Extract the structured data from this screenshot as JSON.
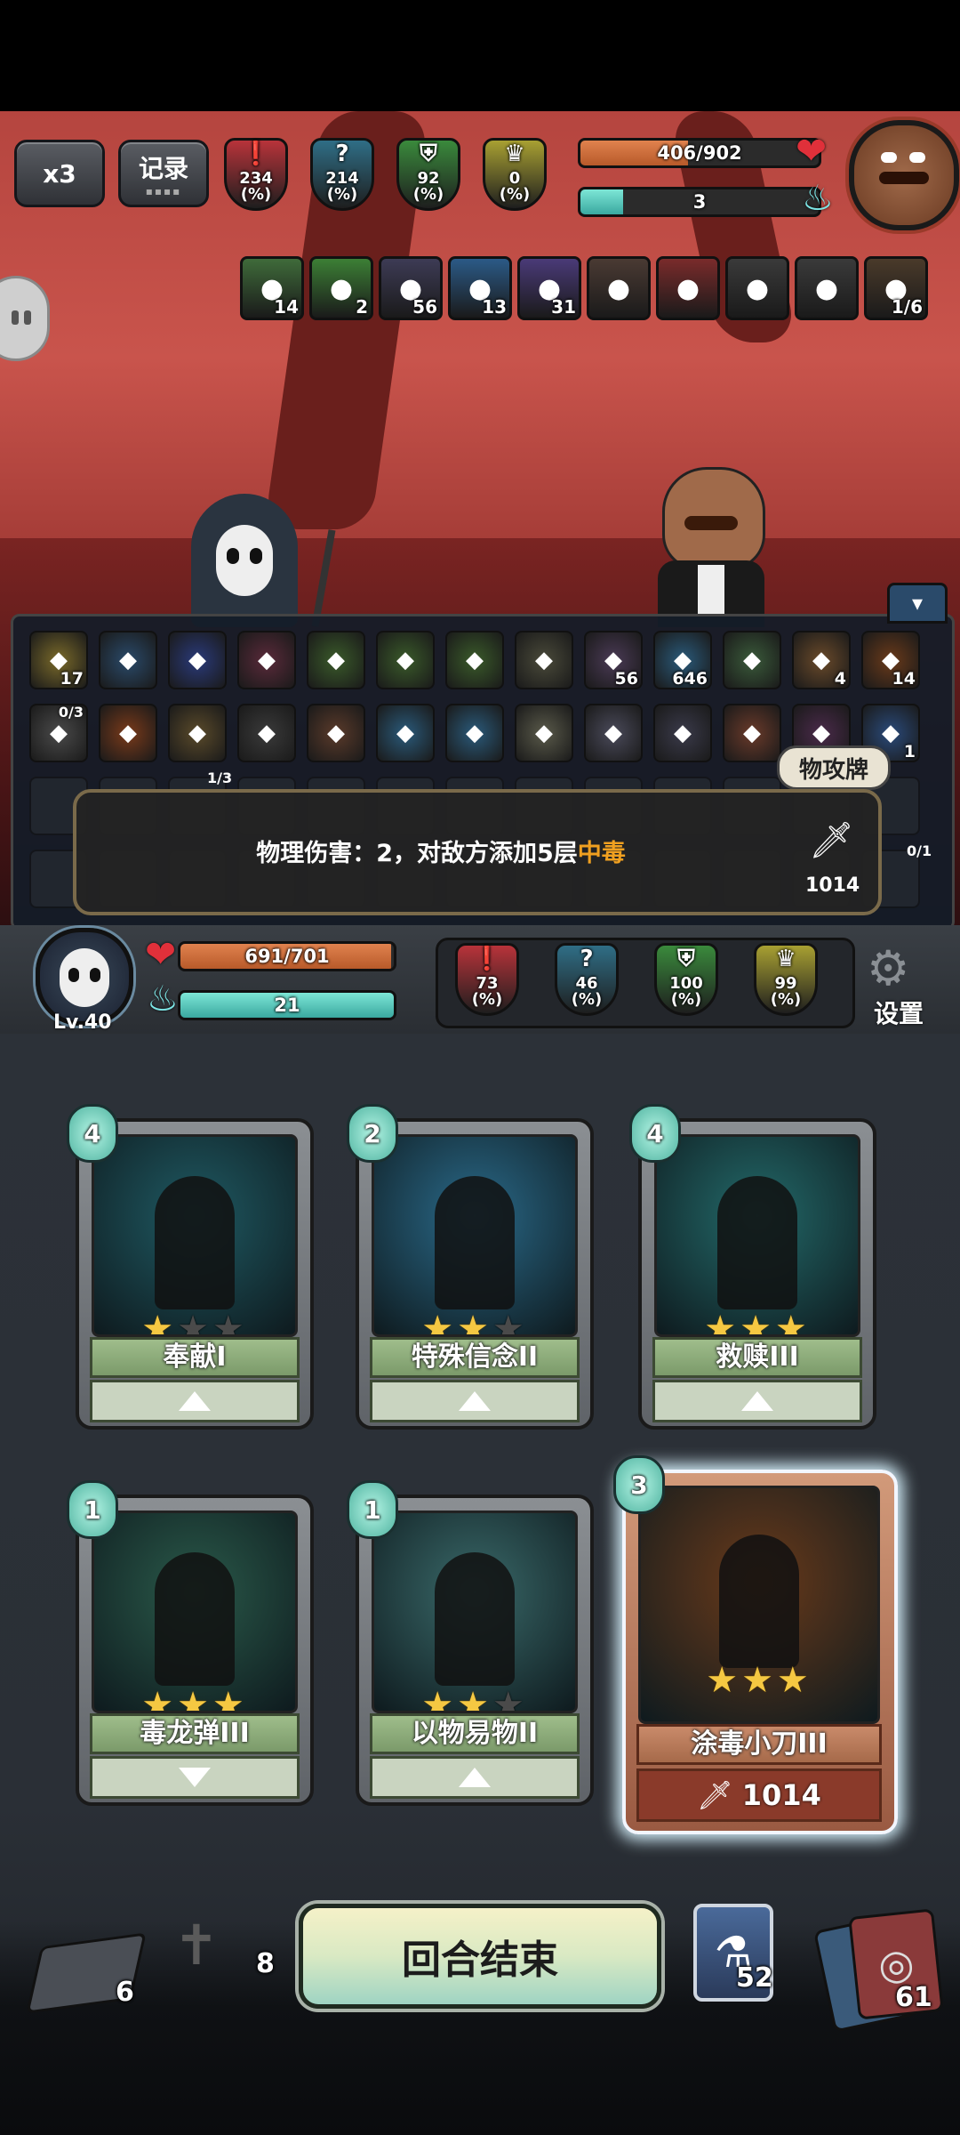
{
  "top_bar": {
    "speed_label": "x3",
    "record_label": "记录"
  },
  "enemy": {
    "hp_text": "406/902",
    "hp_fraction": 0.45,
    "energy_text": "3",
    "energy_fraction": 0.18,
    "stats": [
      {
        "value": "234",
        "unit": "(%)",
        "color": "#b8333a",
        "icon": "attack-icon"
      },
      {
        "value": "214",
        "unit": "(%)",
        "color": "#2f6e86",
        "icon": "question-icon"
      },
      {
        "value": "92",
        "unit": "(%)",
        "color": "#3a8a3c",
        "icon": "shield-icon"
      },
      {
        "value": "0",
        "unit": "(%)",
        "color": "#a8a032",
        "icon": "crown-icon"
      }
    ],
    "statuses": [
      {
        "icon": "skull-poison-icon",
        "count": "14",
        "color": "#3f6b3a"
      },
      {
        "icon": "dragon-icon",
        "count": "2",
        "color": "#3c7f35"
      },
      {
        "icon": "spiral-icon",
        "count": "56",
        "color": "#3d3b55"
      },
      {
        "icon": "blue-shield-icon",
        "count": "13",
        "color": "#2b5a87"
      },
      {
        "icon": "hooded-figure-icon",
        "count": "31",
        "color": "#4a3a78"
      },
      {
        "icon": "book-icon",
        "count": "",
        "color": "#4a3a33"
      },
      {
        "icon": "sausage-icon",
        "count": "",
        "color": "#7a2b2b"
      },
      {
        "icon": "horn-icon",
        "count": "",
        "color": "#3a3a3a"
      },
      {
        "icon": "clock-icon",
        "count": "",
        "color": "#3a3a3a"
      },
      {
        "icon": "scroll-icon",
        "count": "1/6",
        "color": "#4a3a2a"
      }
    ]
  },
  "inventory": {
    "row1": [
      {
        "icon": "clover-icon",
        "count": "17",
        "color": "#7a6a2a"
      },
      {
        "icon": "swirl-drop-icon",
        "count": "",
        "color": "#2a4a6a"
      },
      {
        "icon": "blue-gem-icon",
        "count": "",
        "color": "#2a3a7a"
      },
      {
        "icon": "demon-icon",
        "count": "",
        "color": "#5a2a3a"
      },
      {
        "icon": "green-crystal-icon",
        "count": "",
        "color": "#3a5a2a"
      },
      {
        "icon": "green-crystal-icon",
        "count": "",
        "color": "#3a5a2a"
      },
      {
        "icon": "green-crystal-icon",
        "count": "",
        "color": "#3a5a2a"
      },
      {
        "icon": "gear-cross-icon",
        "count": "",
        "color": "#4a4a3a"
      },
      {
        "icon": "spiral-icon",
        "count": "56",
        "color": "#4a3a55"
      },
      {
        "icon": "ice-mask-icon",
        "count": "646",
        "color": "#2a5a7a"
      },
      {
        "icon": "green-egg-icon",
        "count": "",
        "color": "#3a5a3a"
      },
      {
        "icon": "moon-plus-icon",
        "count": "4",
        "color": "#6a4a2a"
      },
      {
        "icon": "flame-feather-icon",
        "count": "14",
        "color": "#6a3a1a"
      }
    ],
    "row2": [
      {
        "icon": "slot-machine-icon",
        "top": "0/3",
        "count": "",
        "color": "#4a4a4a"
      },
      {
        "icon": "orange-orb-icon",
        "count": "",
        "color": "#7a3a1a"
      },
      {
        "icon": "hammer-icon",
        "count": "",
        "color": "#5a4a2a"
      },
      {
        "icon": "claw-icon",
        "count": "",
        "color": "#3a3a3a"
      },
      {
        "icon": "cross-icon",
        "count": "",
        "color": "#5a3a2a"
      },
      {
        "icon": "water-drop-icon",
        "count": "",
        "color": "#2a5a7a"
      },
      {
        "icon": "blue-egg-icon",
        "count": "",
        "color": "#2a5a7a"
      },
      {
        "icon": "helmet-icon",
        "count": "",
        "color": "#5a5a4a"
      },
      {
        "icon": "wand-icon",
        "count": "",
        "color": "#4a4a5a"
      },
      {
        "icon": "hat-icon",
        "count": "",
        "color": "#3a3a4a"
      },
      {
        "icon": "meat-icon",
        "count": "",
        "color": "#6a3a2a"
      },
      {
        "icon": "fire-sword-icon",
        "count": "",
        "color": "#4a2a4a"
      },
      {
        "icon": "ghost-icon",
        "count": "1",
        "color": "#2a4a7a"
      }
    ],
    "row3_top_label": "1/3",
    "row4_top_label": "0/1",
    "collapse_icon": "chevron-down-icon",
    "tag_label": "物攻牌",
    "tooltip": {
      "text_before": "物理伤害：2，对敌方添加5层",
      "highlight": "中毒",
      "highlight_color": "#f0a020",
      "count": "1014"
    }
  },
  "player": {
    "level": "Lv.40",
    "hp_text": "691/701",
    "hp_fraction": 0.986,
    "energy_text": "21",
    "energy_fraction": 1.0,
    "stats": [
      {
        "value": "73",
        "unit": "(%)",
        "color": "#b8333a",
        "icon": "attack-icon"
      },
      {
        "value": "46",
        "unit": "(%)",
        "color": "#2f6e86",
        "icon": "question-icon"
      },
      {
        "value": "100",
        "unit": "(%)",
        "color": "#3a8a3c",
        "icon": "shield-icon"
      },
      {
        "value": "99",
        "unit": "(%)",
        "color": "#a8a032",
        "icon": "crown-icon"
      }
    ],
    "settings_label": "设置"
  },
  "cards": [
    {
      "cost": "4",
      "name": "奉献I",
      "stars": 1,
      "art": "#1f5a63",
      "action": "upgrade"
    },
    {
      "cost": "2",
      "name": "特殊信念II",
      "stars": 2,
      "art": "#2a6a8a",
      "action": "upgrade"
    },
    {
      "cost": "4",
      "name": "救赎III",
      "stars": 3,
      "art": "#236a6a",
      "action": "upgrade"
    },
    {
      "cost": "1",
      "name": "毒龙弹III",
      "stars": 3,
      "art": "#2a5a4a",
      "action": "down"
    },
    {
      "cost": "1",
      "name": "以物易物II",
      "stars": 2,
      "art": "#3a6a6a",
      "action": "upgrade"
    },
    {
      "cost": "3",
      "name": "涂毒小刀III",
      "stars": 3,
      "art": "#6a3a1a",
      "action": "count",
      "count": "1014",
      "selected": true
    }
  ],
  "bottom": {
    "draw_pile": "6",
    "grave": "8",
    "end_turn_label": "回合结束",
    "potion": "52",
    "deck": "61"
  }
}
